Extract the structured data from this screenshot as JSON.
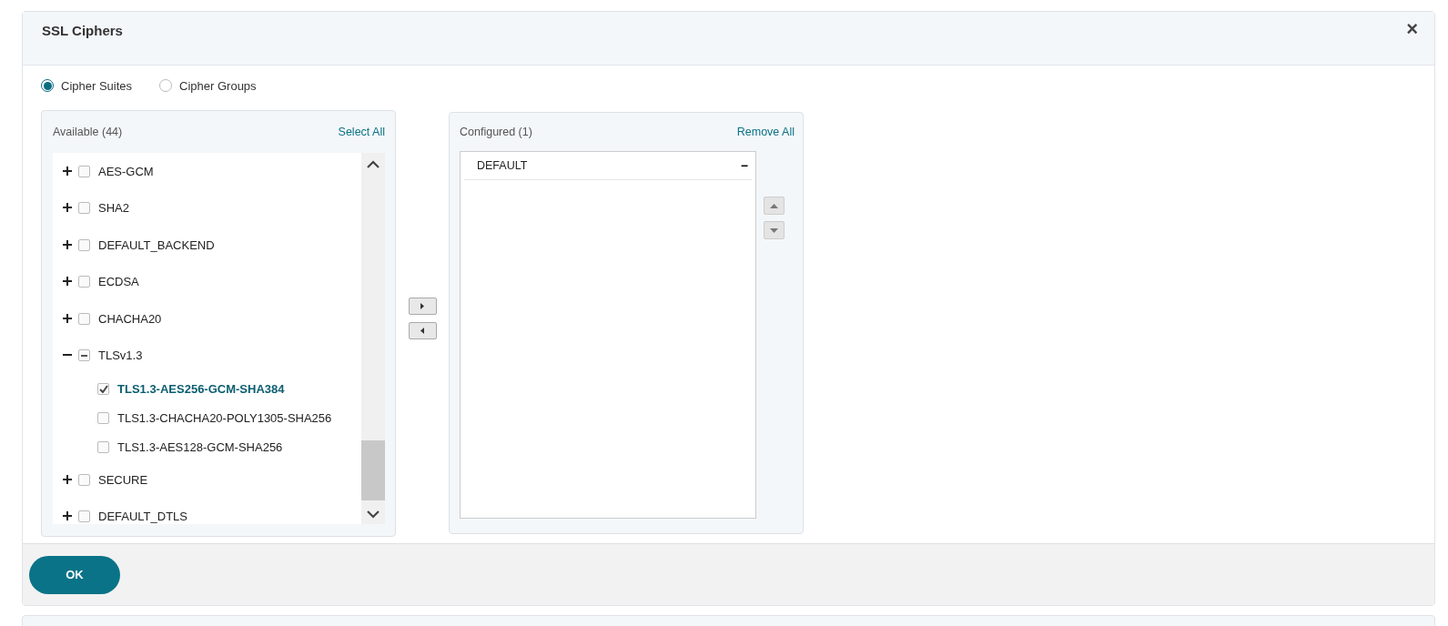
{
  "dialog": {
    "title": "SSL Ciphers",
    "close": "×"
  },
  "radios": [
    {
      "label": "Cipher Suites",
      "selected": true
    },
    {
      "label": "Cipher Groups",
      "selected": false
    }
  ],
  "available": {
    "title": "Available (44)",
    "action": "Select All",
    "items": [
      {
        "label": "AES-GCM",
        "expanded": false,
        "checked": false,
        "partial": false
      },
      {
        "label": "SHA2",
        "expanded": false,
        "checked": false,
        "partial": false
      },
      {
        "label": "DEFAULT_BACKEND",
        "expanded": false,
        "checked": false,
        "partial": false
      },
      {
        "label": "ECDSA",
        "expanded": false,
        "checked": false,
        "partial": false
      },
      {
        "label": "CHACHA20",
        "expanded": false,
        "checked": false,
        "partial": false
      },
      {
        "label": "TLSv1.3",
        "expanded": true,
        "checked": false,
        "partial": true,
        "children": [
          {
            "label": "TLS1.3-AES256-GCM-SHA384",
            "checked": true
          },
          {
            "label": "TLS1.3-CHACHA20-POLY1305-SHA256",
            "checked": false
          },
          {
            "label": "TLS1.3-AES128-GCM-SHA256",
            "checked": false
          }
        ]
      },
      {
        "label": "SECURE",
        "expanded": false,
        "checked": false,
        "partial": false
      },
      {
        "label": "DEFAULT_DTLS",
        "expanded": false,
        "checked": false,
        "partial": false
      }
    ]
  },
  "configured": {
    "title": "Configured (1)",
    "action": "Remove All",
    "items": [
      {
        "label": "DEFAULT",
        "remove": "−"
      }
    ]
  },
  "footer": {
    "ok": "OK"
  }
}
